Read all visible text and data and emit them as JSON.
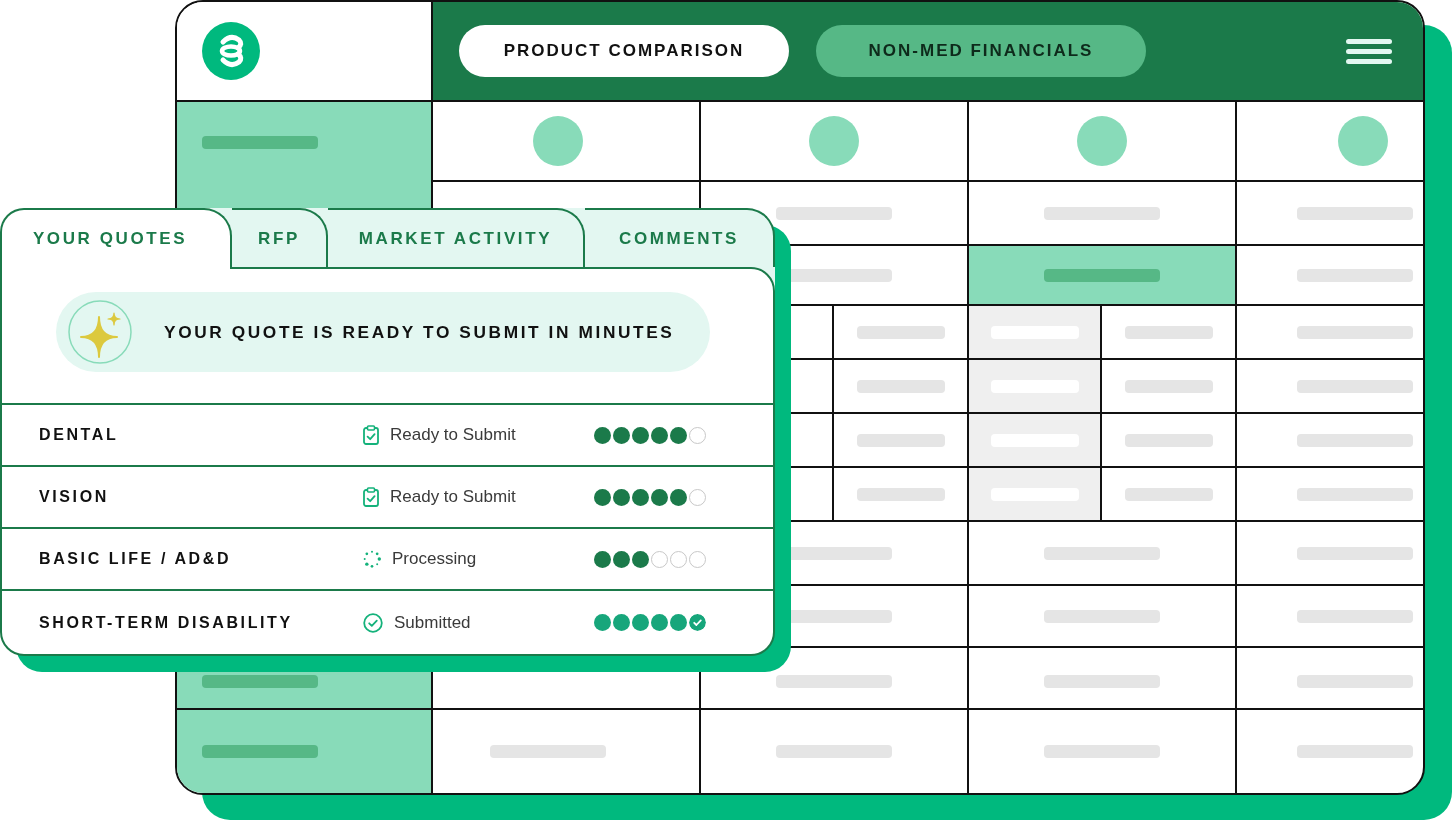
{
  "header": {
    "nav_tabs": [
      {
        "label": "PRODUCT COMPARISON",
        "selected": true
      },
      {
        "label": "NON-MED FINANCIALS",
        "selected": false
      }
    ]
  },
  "comparison_table": {
    "rows": [
      {
        "kind": "avatars",
        "highlighted": false
      },
      {
        "kind": "bars",
        "highlighted": false
      },
      {
        "kind": "bars",
        "highlighted": true
      },
      {
        "kind": "split",
        "highlighted": false
      },
      {
        "kind": "split",
        "highlighted": false
      },
      {
        "kind": "split",
        "highlighted": false
      },
      {
        "kind": "split",
        "highlighted": false
      },
      {
        "kind": "bars",
        "highlighted": false
      },
      {
        "kind": "bars",
        "highlighted": false
      },
      {
        "kind": "bars",
        "highlighted": false
      },
      {
        "kind": "bars",
        "highlighted": false
      }
    ]
  },
  "quotes_panel": {
    "tabs": [
      {
        "label": "YOUR QUOTES",
        "selected": true
      },
      {
        "label": "RFP",
        "selected": false
      },
      {
        "label": "MARKET ACTIVITY",
        "selected": false
      },
      {
        "label": "COMMENTS",
        "selected": false
      }
    ],
    "banner": {
      "message": "YOUR QUOTE IS READY TO SUBMIT IN MINUTES"
    },
    "quotes": [
      {
        "name": "DENTAL",
        "status": {
          "kind": "ready",
          "label": "Ready to Submit"
        },
        "stars": 5
      },
      {
        "name": "VISION",
        "status": {
          "kind": "ready",
          "label": "Ready to Submit"
        },
        "stars": 5
      },
      {
        "name": "BASIC LIFE / AD&D",
        "status": {
          "kind": "processing",
          "label": "Processing"
        },
        "stars": 3
      },
      {
        "name": "SHORT-TERM DISABILITY",
        "status": {
          "kind": "submitted",
          "label": "Submitted"
        },
        "stars": 5
      }
    ]
  }
}
